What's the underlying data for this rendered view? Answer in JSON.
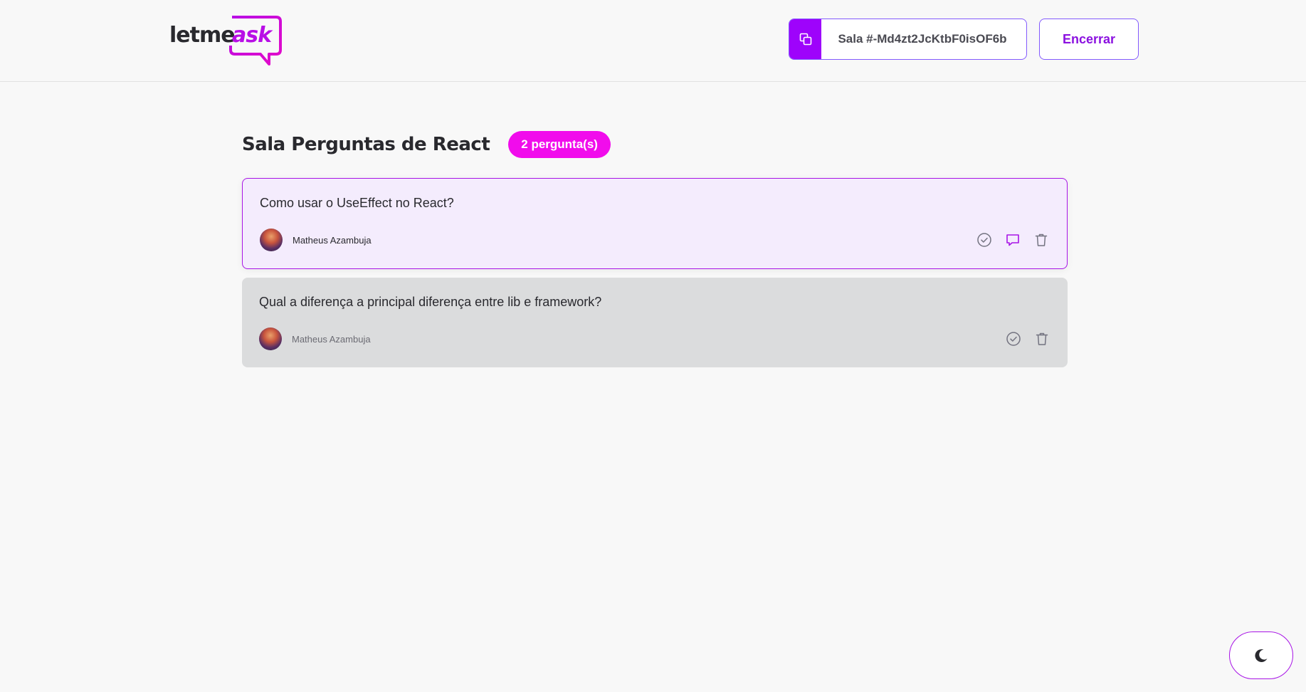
{
  "header": {
    "logo": {
      "part1": "letme",
      "part2": "ask"
    },
    "room_code": {
      "label": "Sala #-Md4zt2JcKtbF0isOF6b",
      "icon": "copy-icon"
    },
    "close_button": "Encerrar"
  },
  "room": {
    "title": "Sala Perguntas de React",
    "question_count": "2 pergunta(s)"
  },
  "questions": [
    {
      "text": "Como usar o UseEffect no React?",
      "author": "Matheus Azambuja",
      "highlighted": true,
      "actions": [
        "check-circle-icon",
        "chat-bubble-icon",
        "trash-icon"
      ]
    },
    {
      "text": "Qual a diferença a principal diferença entre lib e framework?",
      "author": "Matheus Azambuja",
      "answered": true,
      "actions": [
        "check-circle-icon",
        "trash-icon"
      ]
    }
  ],
  "theme_toggle": {
    "icon": "moon-icon"
  },
  "colors": {
    "brand": "#835afd",
    "accent_pink": "#f10cec",
    "copy_bg": "#9e03fb",
    "highlight_bg": "#f4ecfd",
    "answered_bg": "#dbdcdd"
  }
}
